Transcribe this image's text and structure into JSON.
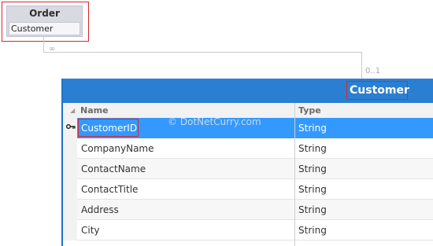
{
  "order_entity": {
    "title": "Order",
    "properties": [
      "Customer"
    ]
  },
  "association": {
    "order_multiplicity": "∞",
    "customer_multiplicity": "0..1"
  },
  "customer_entity": {
    "title": "Customer",
    "columns": {
      "name": "Name",
      "type": "Type"
    },
    "properties": [
      {
        "name": "CustomerID",
        "type": "String",
        "is_key": true,
        "selected": true
      },
      {
        "name": "CompanyName",
        "type": "String"
      },
      {
        "name": "ContactName",
        "type": "String"
      },
      {
        "name": "ContactTitle",
        "type": "String"
      },
      {
        "name": "Address",
        "type": "String"
      },
      {
        "name": "City",
        "type": "String"
      }
    ]
  },
  "watermark": "© DotNetCurry.com",
  "colors": {
    "header_blue": "#2a7fd3",
    "selection_blue": "#3399ff",
    "highlight_red": "#d9262c",
    "order_header_gray": "#d9d9e2"
  },
  "icons": {
    "key": "key-icon",
    "sort": "sort-indicator-icon"
  }
}
